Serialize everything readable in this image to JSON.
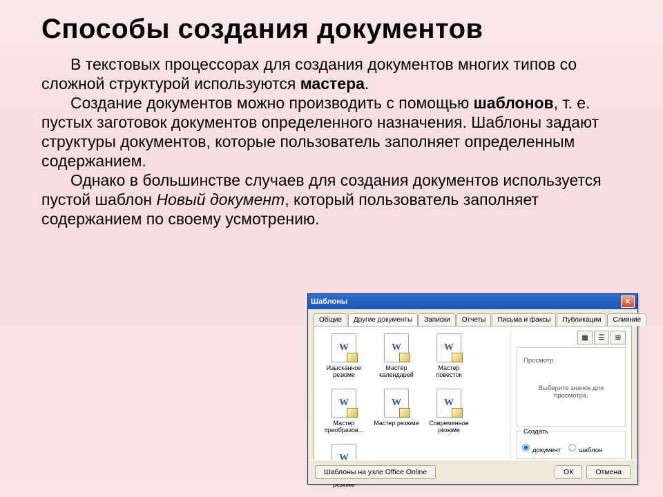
{
  "title": "Способы создания документов",
  "p1a": "В текстовых процессорах для создания документов многих типов со сложной структурой используются ",
  "p1b": "мастера",
  "p1c": ".",
  "p2a": "Создание документов можно производить с помощью ",
  "p2b": "шаблонов",
  "p2c": ", т. е. пустых заготовок документов определенного назначения. Шаблоны задают структуры документов, которые пользователь заполняет определенным содержанием.",
  "p3a": "Однако в большинстве случаев для создания документов используется пустой шаблон ",
  "p3b": "Новый документ",
  "p3c": ", который пользователь заполняет содержанием по своему усмотрению.",
  "dialog": {
    "title": "Шаблоны",
    "close": "✕",
    "tabs": [
      "Общие",
      "Другие документы",
      "Записки",
      "Отчеты",
      "Письма и факсы",
      "Публикации",
      "Слияние"
    ],
    "activeTab": 1,
    "items": [
      "Изысканное резюме",
      "Мастер календарей",
      "Мастер повесток",
      "Мастер преобразов...",
      "Мастер резюме",
      "Современное резюме",
      "Стандартное резюме"
    ],
    "previewTitle": "Просмотр",
    "previewText": "Выберите значок для просмотра.",
    "createTitle": "Создать",
    "radioDoc": "документ",
    "radioTpl": "шаблон",
    "officeOnline": "Шаблоны на узле Office Online",
    "ok": "ОК",
    "cancel": "Отмена"
  }
}
